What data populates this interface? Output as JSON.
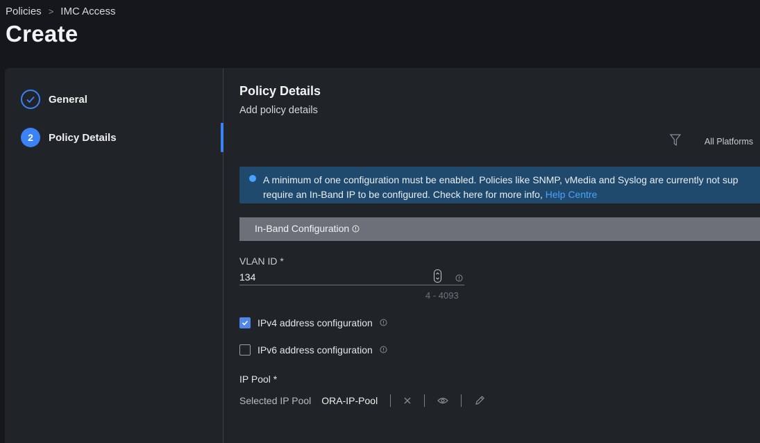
{
  "breadcrumb": {
    "items": [
      "Policies",
      "IMC Access"
    ],
    "separator": ">"
  },
  "page": {
    "title": "Create"
  },
  "steps": [
    {
      "label": "General",
      "state": "completed",
      "icon": "check-icon"
    },
    {
      "label": "Policy Details",
      "state": "current",
      "number": "2"
    }
  ],
  "main": {
    "title": "Policy Details",
    "subtitle": "Add policy details",
    "filter": {
      "label": "All Platforms",
      "icon": "filter-icon"
    },
    "banner": {
      "line1": "A minimum of one configuration must be enabled. Policies like SNMP, vMedia and Syslog are currently not sup",
      "line2": "require an In-Band IP to be configured. Check here for more info,",
      "link": "Help Centre"
    },
    "section": {
      "label": "In-Band Configuration"
    },
    "vlan": {
      "label": "VLAN ID *",
      "value": "134",
      "range": "4 - 4093"
    },
    "ipv4": {
      "label": "IPv4 address configuration",
      "checked": true
    },
    "ipv6": {
      "label": "IPv6 address configuration",
      "checked": false
    },
    "ip_pool": {
      "label": "IP Pool *",
      "caption": "Selected IP Pool",
      "value": "ORA-IP-Pool"
    }
  },
  "colors": {
    "accent": "#3b82f6",
    "banner": "#1f4a6e",
    "link": "#4aa3ff",
    "background": "#15171a",
    "panel": "#202328"
  }
}
